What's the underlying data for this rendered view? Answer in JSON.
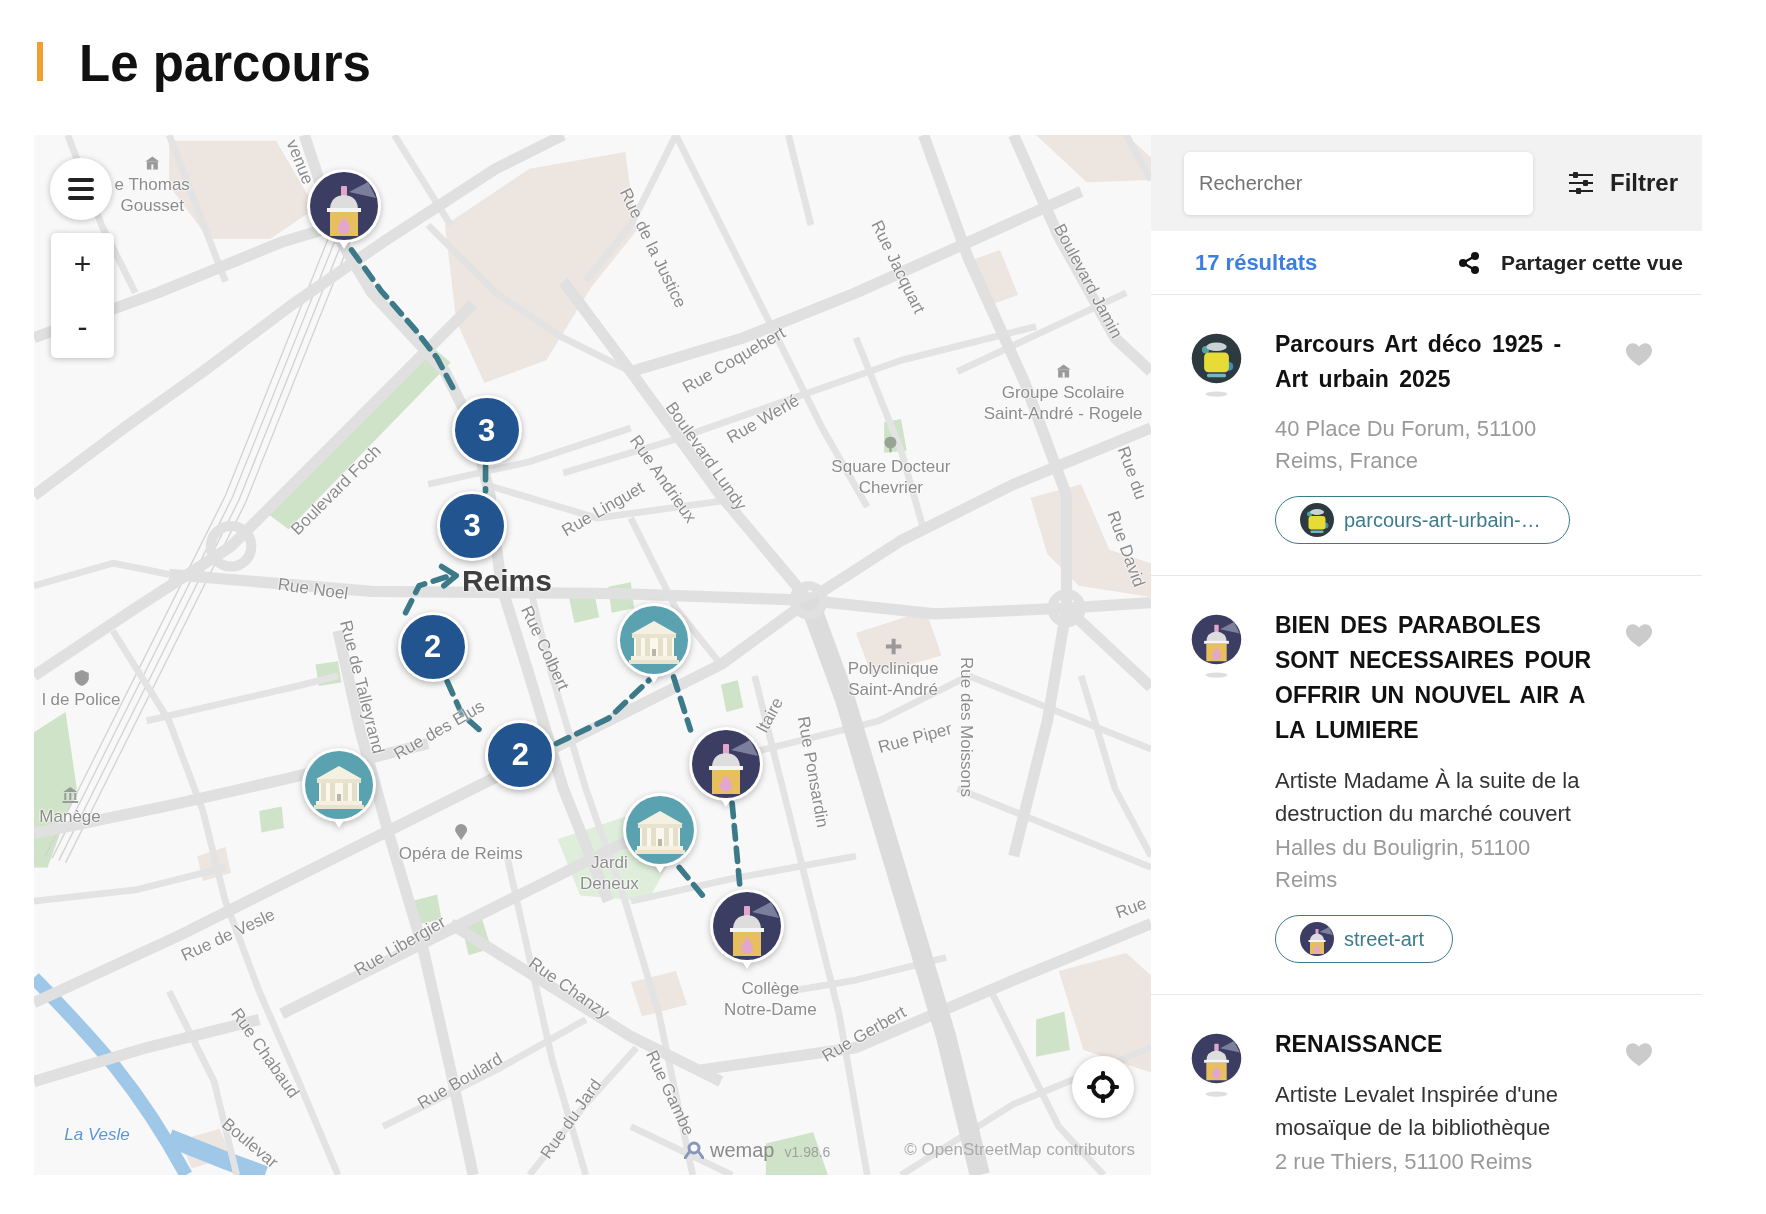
{
  "page": {
    "title": "Le parcours"
  },
  "map": {
    "zoom_controls": [
      "+",
      "-"
    ],
    "labels": [
      {
        "kind": "school",
        "lines": [
          "e Thomas",
          "Gousset"
        ]
      },
      {
        "kind": "street",
        "text": "venue"
      },
      {
        "kind": "street",
        "text": "Rue de la Justice"
      },
      {
        "kind": "street",
        "text": "Rue Jacquart"
      },
      {
        "kind": "street",
        "text": "Boulevard Jamin"
      },
      {
        "kind": "street",
        "text": "Rue Coquebert"
      },
      {
        "kind": "school",
        "lines": [
          "Groupe Scolaire",
          "Saint-André - Rogele"
        ]
      },
      {
        "kind": "street",
        "text": "Rue Werlé"
      },
      {
        "kind": "street",
        "text": "Boulevard Lundy"
      },
      {
        "kind": "street",
        "text": "Rue Andrieux"
      },
      {
        "kind": "park",
        "lines": [
          "Square Docteur",
          "Chevrier"
        ]
      },
      {
        "kind": "street",
        "text": "Rue du"
      },
      {
        "kind": "street",
        "text": "Rue Linguet"
      },
      {
        "kind": "street",
        "text": "Boulevard Foch"
      },
      {
        "kind": "street",
        "text": "Rue David"
      },
      {
        "kind": "city",
        "text": "Reims"
      },
      {
        "kind": "street",
        "text": "Rue Noel"
      },
      {
        "kind": "street",
        "text": "Rue Colbert"
      },
      {
        "kind": "clinic",
        "lines": [
          "Polyclinique",
          "Saint-André"
        ]
      },
      {
        "kind": "street",
        "text": "Rue de Talleyrand"
      },
      {
        "kind": "police",
        "lines": [
          "l de Police"
        ]
      },
      {
        "kind": "street",
        "text": "Rue des Elus"
      },
      {
        "kind": "street",
        "text": "ltaire"
      },
      {
        "kind": "street",
        "text": "Rue Ponsardin"
      },
      {
        "kind": "street",
        "text": "Rue Piper"
      },
      {
        "kind": "street",
        "text": "Rue des Moissons"
      },
      {
        "kind": "museum",
        "lines": [
          "Manège"
        ]
      },
      {
        "kind": "venue",
        "lines": [
          "Opéra de Reims"
        ]
      },
      {
        "kind": "place",
        "lines": [
          "Jardi",
          "Deneux"
        ]
      },
      {
        "kind": "street",
        "text": "Rue"
      },
      {
        "kind": "street",
        "text": "Rue de Vesle"
      },
      {
        "kind": "street",
        "text": "Rue Libergier"
      },
      {
        "kind": "street",
        "text": "Rue Chanzy"
      },
      {
        "kind": "place",
        "lines": [
          "Collège",
          "Notre-Dame"
        ]
      },
      {
        "kind": "street",
        "text": "Rue Gerbert"
      },
      {
        "kind": "street",
        "text": "Rue Chabaud"
      },
      {
        "kind": "street",
        "text": "Rue Boulard"
      },
      {
        "kind": "street",
        "text": "Rue du Jard"
      },
      {
        "kind": "street",
        "text": "Rue Gambe"
      },
      {
        "kind": "street",
        "text": "Boulevar"
      },
      {
        "kind": "water",
        "text": "La Vesle"
      }
    ],
    "markers": [
      {
        "kind": "spray"
      },
      {
        "kind": "cluster",
        "count": "3"
      },
      {
        "kind": "cluster",
        "count": "3"
      },
      {
        "kind": "cluster",
        "count": "2"
      },
      {
        "kind": "museum"
      },
      {
        "kind": "cluster",
        "count": "2"
      },
      {
        "kind": "spray"
      },
      {
        "kind": "museum"
      },
      {
        "kind": "museum"
      },
      {
        "kind": "spray"
      }
    ],
    "attribution": {
      "brand": "wemap",
      "version": "v1.98.6",
      "credit": "© OpenStreetMap contributors"
    }
  },
  "sidebar": {
    "search": {
      "placeholder": "Rechercher"
    },
    "filter_button": "Filtrer",
    "results_count": "17 résultats",
    "share_button": "Partager cette vue",
    "results": [
      {
        "kind": "logo",
        "title": "Parcours Art déco 1925 - Art urbain 2025",
        "address": "40 Place Du Forum, 51100 Reims, France",
        "tag": "parcours-art-urbain-…",
        "favorite": false
      },
      {
        "kind": "spray",
        "title": "BIEN DES PARABOLES SONT NECESSAIRES POUR OFFRIR UN NOUVEL AIR A LA LUMIERE",
        "description": "Artiste Madame À la suite de la destruction du marché couvert",
        "address": "Halles du Bouligrin, 51100 Reims",
        "tag": "street-art",
        "favorite": false
      },
      {
        "kind": "spray",
        "title": "RENAISSANCE",
        "description": "Artiste Levalet Inspirée d'une mosaïque de la bibliothèque",
        "address": "2 rue Thiers, 51100 Reims",
        "favorite": false
      }
    ]
  }
}
